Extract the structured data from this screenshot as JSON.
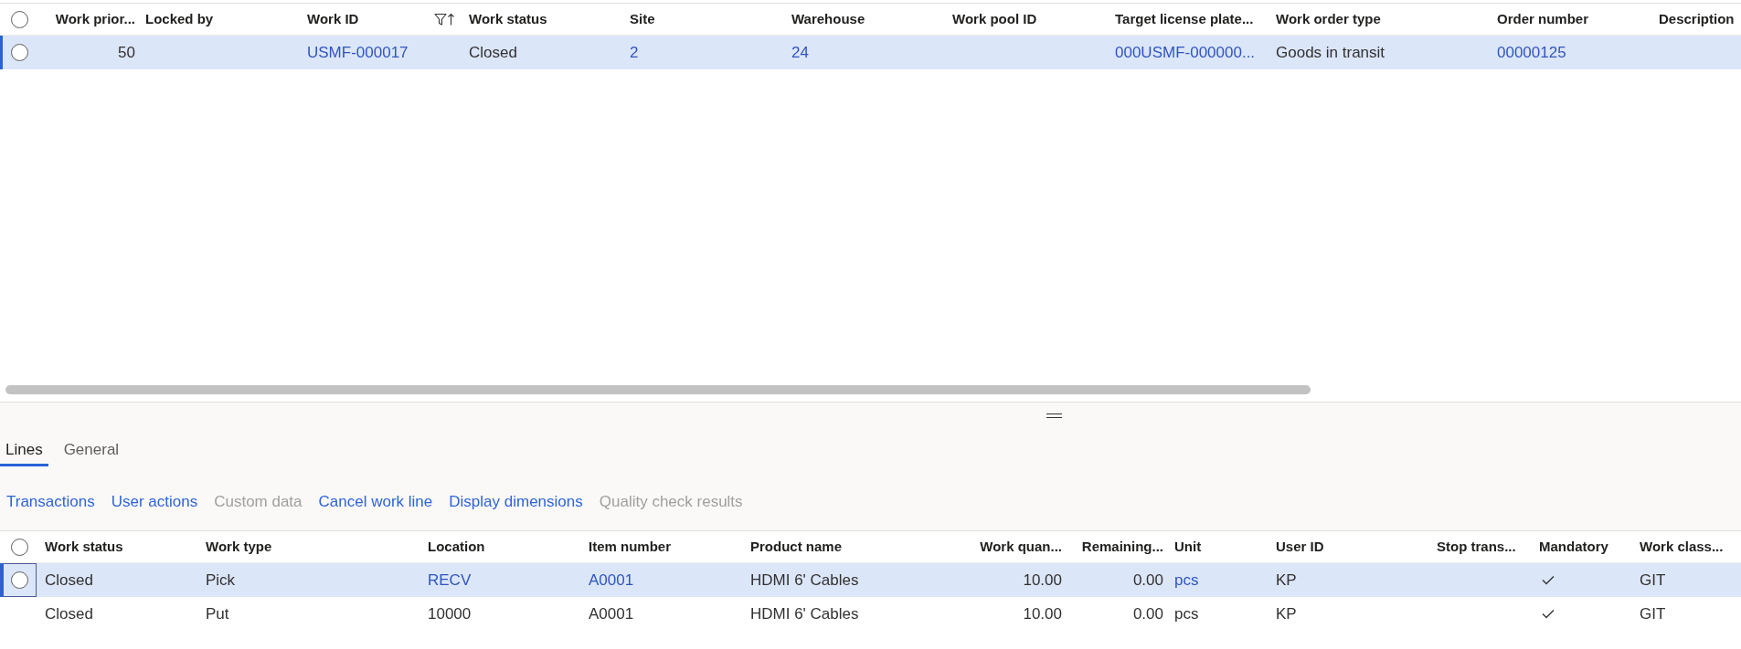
{
  "top_grid": {
    "select_all": {
      "checked": false
    },
    "columns": [
      {
        "label": "Work prior...",
        "kind": "number",
        "filtered": false,
        "sorted": false
      },
      {
        "label": "Locked by",
        "kind": "text",
        "filtered": false,
        "sorted": false
      },
      {
        "label": "Work ID",
        "kind": "link",
        "filtered": true,
        "sorted": true
      },
      {
        "label": "Work status",
        "kind": "text",
        "filtered": false,
        "sorted": false
      },
      {
        "label": "Site",
        "kind": "link",
        "filtered": false,
        "sorted": false
      },
      {
        "label": "Warehouse",
        "kind": "link",
        "filtered": false,
        "sorted": false
      },
      {
        "label": "Work pool ID",
        "kind": "text",
        "filtered": false,
        "sorted": false
      },
      {
        "label": "Target license plate...",
        "kind": "link",
        "filtered": false,
        "sorted": false
      },
      {
        "label": "Work order type",
        "kind": "text",
        "filtered": false,
        "sorted": false
      },
      {
        "label": "Order number",
        "kind": "link",
        "filtered": false,
        "sorted": false
      },
      {
        "label": "Description",
        "kind": "text",
        "filtered": false,
        "sorted": false
      }
    ],
    "rows": [
      {
        "selected": true,
        "focused": false,
        "cells": [
          "50",
          null,
          "USMF-000017",
          "Closed",
          "2",
          "24",
          null,
          "000USMF-000000...",
          "Goods in transit",
          "00000125",
          null
        ]
      }
    ]
  },
  "tabs": [
    {
      "label": "Lines",
      "selected": true
    },
    {
      "label": "General",
      "selected": false
    }
  ],
  "actions": [
    {
      "label": "Transactions",
      "disabled": false
    },
    {
      "label": "User actions",
      "disabled": false
    },
    {
      "label": "Custom data",
      "disabled": true
    },
    {
      "label": "Cancel work line",
      "disabled": false
    },
    {
      "label": "Display dimensions",
      "disabled": false
    },
    {
      "label": "Quality check results",
      "disabled": true
    }
  ],
  "lines_grid": {
    "select_all": {
      "checked": false
    },
    "columns": [
      {
        "label": "Work status",
        "kind": "text"
      },
      {
        "label": "Work type",
        "kind": "text"
      },
      {
        "label": "Location",
        "kind": "link"
      },
      {
        "label": "Item number",
        "kind": "link"
      },
      {
        "label": "Product name",
        "kind": "text"
      },
      {
        "label": "Work quan...",
        "kind": "number"
      },
      {
        "label": "Remaining...",
        "kind": "number"
      },
      {
        "label": "Unit",
        "kind": "link"
      },
      {
        "label": "User ID",
        "kind": "text"
      },
      {
        "label": "Stop trans...",
        "kind": "check"
      },
      {
        "label": "Mandatory",
        "kind": "check"
      },
      {
        "label": "Work class...",
        "kind": "text"
      }
    ],
    "rows": [
      {
        "selected": true,
        "focused": true,
        "cells": [
          "Closed",
          "Pick",
          "RECV",
          "A0001",
          "HDMI 6' Cables",
          "10.00",
          "0.00",
          "pcs",
          "KP",
          null,
          {
            "checked": true
          },
          "GIT"
        ]
      },
      {
        "selected": false,
        "focused": false,
        "cells": [
          "Closed",
          "Put",
          "10000",
          "A0001",
          "HDMI 6' Cables",
          "10.00",
          "0.00",
          "pcs",
          "KP",
          null,
          {
            "checked": true
          },
          "GIT"
        ]
      }
    ]
  }
}
